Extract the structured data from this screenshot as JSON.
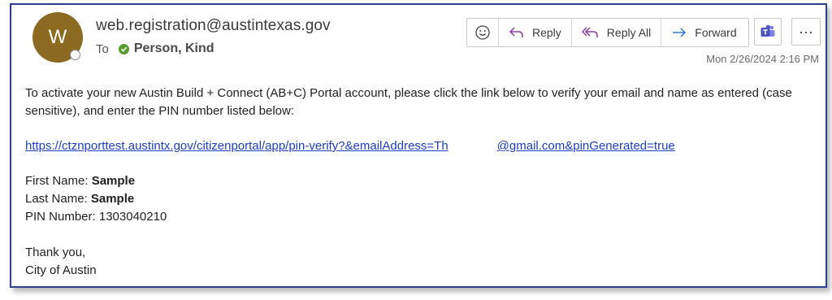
{
  "header": {
    "avatar_initial": "W",
    "sender": "web.registration@austintexas.gov",
    "to_label": "To",
    "recipient": "Person, Kind",
    "timestamp": "Mon 2/26/2024 2:16 PM"
  },
  "toolbar": {
    "emoji_icon": "smiley-icon",
    "reply_label": "Reply",
    "reply_all_label": "Reply All",
    "forward_label": "Forward",
    "teams_icon": "teams-icon",
    "more_label": "···"
  },
  "body": {
    "intro": "To activate your new Austin Build + Connect (AB+C) Portal account, please click the link below to verify your email and name as entered (case sensitive), and enter the PIN number listed below:",
    "link_part1": "https://ctznporttest.austintx.gov/citizenportal/app/pin-verify?&emailAddress=Th",
    "link_part2": "@gmail.com&pinGenerated=true",
    "first_name_label": "First Name: ",
    "first_name_value": "Sample",
    "last_name_label": "Last Name: ",
    "last_name_value": "Sample",
    "pin_label": "PIN Number: ",
    "pin_value": "1303040210",
    "closing": "Thank you,",
    "signature": "City of Austin"
  },
  "colors": {
    "avatar": "#8d6a22",
    "presence_check": "#5b9b2d",
    "link": "#1f3dbd",
    "frame_border": "#2e3f8f",
    "reply_arrow": "#8a3fa0",
    "forward_arrow": "#2f7bd6"
  }
}
